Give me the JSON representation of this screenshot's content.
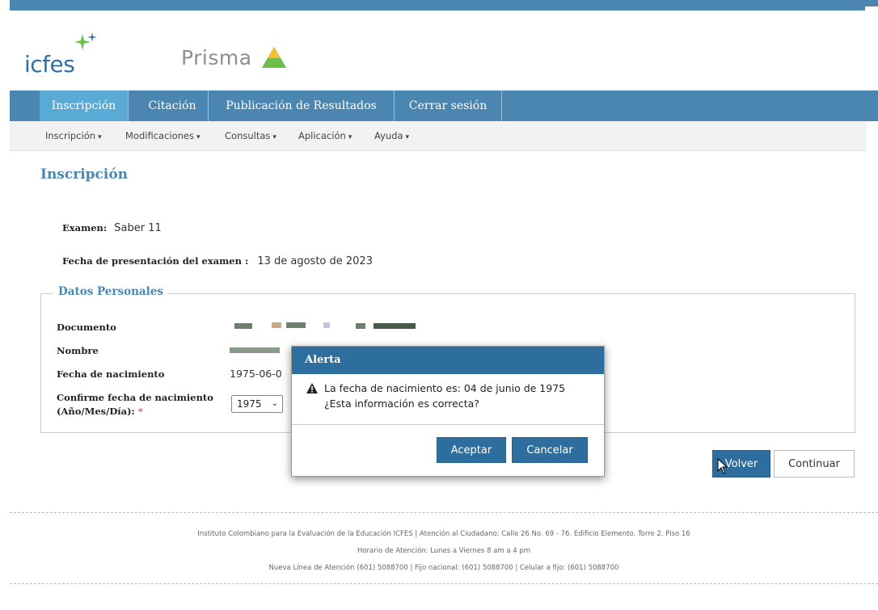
{
  "brand": {
    "logo_text": "icfes",
    "app_name": "Prisma"
  },
  "nav": {
    "tabs": [
      "Inscripción",
      "Citación",
      "Publicación de Resultados",
      "Cerrar sesión"
    ]
  },
  "subnav": {
    "items": [
      "Inscripción",
      "Modificaciones",
      "Consultas",
      "Aplicación",
      "Ayuda"
    ]
  },
  "page": {
    "title": "Inscripción",
    "examen_label": "Examen:",
    "examen_value": "Saber 11",
    "fecha_label": "Fecha de presentación del examen :",
    "fecha_value": "13 de agosto de 2023"
  },
  "personal": {
    "legend": "Datos Personales",
    "documento_label": "Documento",
    "nombre_label": "Nombre",
    "nacimiento_label": "Fecha de nacimiento",
    "nacimiento_value": "1975-06-0",
    "confirm_label_1": "Confirme fecha de nacimiento",
    "confirm_label_2": "(Año/Mes/Día):",
    "required_mark": "*",
    "year_selected": "1975"
  },
  "actions": {
    "volver": "Volver",
    "continuar": "Continuar"
  },
  "modal": {
    "title": "Alerta",
    "message": "La fecha de nacimiento es: 04 de junio de 1975 ¿Esta información es correcta?",
    "accept": "Aceptar",
    "cancel": "Cancelar"
  },
  "footer": {
    "line1": "Instituto Colombiano para la Evaluación de la Educación ICFES  |  Atención al Ciudadano: Calle 26 No. 69 - 76. Edificio Elemento. Torre 2. Piso 16",
    "line2": "Horario de Atención: Lunes a Viernes 8 am a 4 pm",
    "line3": "Nueva Línea de Atención (601) 5088700  |  Fijo nacional: (601) 5088700  |  Celular a fijo: (601) 5088700"
  },
  "colors": {
    "primary": "#4a86b0",
    "active_tab": "#5aaad6",
    "button": "#2e6e9e"
  }
}
